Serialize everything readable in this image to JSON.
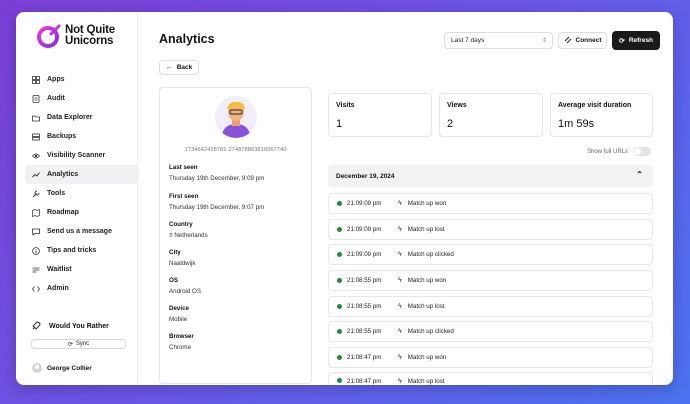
{
  "app": {
    "logo_line1": "Not Quite",
    "logo_line2": "Unicorns",
    "brand_color": "#c02fd8"
  },
  "sidebar": {
    "items": [
      {
        "label": "Apps",
        "icon": "grid-icon"
      },
      {
        "label": "Audit",
        "icon": "audit-icon"
      },
      {
        "label": "Data Explorer",
        "icon": "folder-icon"
      },
      {
        "label": "Backups",
        "icon": "backup-icon"
      },
      {
        "label": "Visibility Scanner",
        "icon": "eye-icon"
      },
      {
        "label": "Analytics",
        "icon": "chart-icon",
        "active": true
      },
      {
        "label": "Tools",
        "icon": "wrench-icon"
      },
      {
        "label": "Roadmap",
        "icon": "map-icon"
      },
      {
        "label": "Send us a message",
        "icon": "message-icon"
      },
      {
        "label": "Tips and tricks",
        "icon": "info-icon"
      },
      {
        "label": "Waitlist",
        "icon": "waitlist-icon"
      },
      {
        "label": "Admin",
        "icon": "code-icon"
      }
    ],
    "project_name": "Would You Rather",
    "sync_label": "Sync",
    "user_name": "George Collier"
  },
  "header": {
    "title": "Analytics",
    "range_select": "Last 7 days",
    "connect_label": "Connect",
    "refresh_label": "Refresh",
    "back_label": "Back"
  },
  "visitor": {
    "id": "1734642428781-274878863816067740",
    "fields": [
      {
        "label": "Last seen",
        "value": "Thursday 19th December, 9:09 pm"
      },
      {
        "label": "First seen",
        "value": "Thursday 19th December, 9:07 pm"
      },
      {
        "label": "Country",
        "value": "≡ Netherlands"
      },
      {
        "label": "City",
        "value": "Naaldwijk"
      },
      {
        "label": "OS",
        "value": "Android OS"
      },
      {
        "label": "Device",
        "value": "Mobile"
      },
      {
        "label": "Browser",
        "value": "Chrome"
      }
    ]
  },
  "stats": [
    {
      "label": "Visits",
      "value": "1"
    },
    {
      "label": "Views",
      "value": "2"
    },
    {
      "label": "Average visit duration",
      "value": "1m 59s"
    }
  ],
  "toggle_label": "Show full URLs",
  "events_date": "December 19, 2024",
  "events": [
    {
      "time": "21:09:09 pm",
      "name": "Match up won"
    },
    {
      "time": "21:09:09 pm",
      "name": "Match up lost"
    },
    {
      "time": "21:09:09 pm",
      "name": "Match up clicked"
    },
    {
      "time": "21:08:55 pm",
      "name": "Match up won"
    },
    {
      "time": "21:08:55 pm",
      "name": "Match up lost"
    },
    {
      "time": "21:08:55 pm",
      "name": "Match up clicked"
    },
    {
      "time": "21:08:47 pm",
      "name": "Match up won"
    },
    {
      "time": "21:08:47 pm",
      "name": "Match up lost"
    }
  ],
  "status_color": "#1f8a3a"
}
